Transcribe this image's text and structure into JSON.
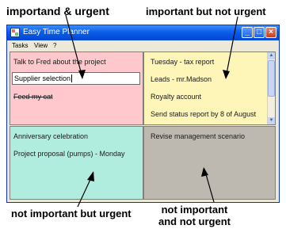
{
  "annotations": {
    "top_left": "importand & urgent",
    "top_right": "important but not urgent",
    "bottom_left": "not important but urgent",
    "bottom_right_line1": "not important",
    "bottom_right_line2": "and not urgent"
  },
  "window": {
    "title": "Easy Time Planner",
    "minimize_glyph": "_",
    "maximize_glyph": "□",
    "close_glyph": "×"
  },
  "menu": {
    "items": [
      "Tasks",
      "View",
      "?"
    ]
  },
  "quadrants": {
    "important_urgent": {
      "tasks": [
        "Talk to Fred about the project",
        "Feed my cat"
      ],
      "edit_value": "Supplier selection",
      "done_task": "Feed my cat"
    },
    "important_not_urgent": {
      "tasks": [
        "Tuesday - tax report",
        "Leads - mr.Madson",
        "Royalty account",
        "Send status report by 8 of August"
      ]
    },
    "not_important_urgent": {
      "tasks": [
        "Anniversary celebration",
        "Project proposal (pumps) - Monday"
      ]
    },
    "not_important_not_urgent": {
      "tasks": [
        "Revise management scenario"
      ]
    }
  },
  "colors": {
    "important_urgent": "#FFC8CC",
    "important_not_urgent": "#FDF6B8",
    "not_important_urgent": "#B0EDDE",
    "not_important_not_urgent": "#BDB9B1",
    "titlebar": "#0A5EE8"
  }
}
